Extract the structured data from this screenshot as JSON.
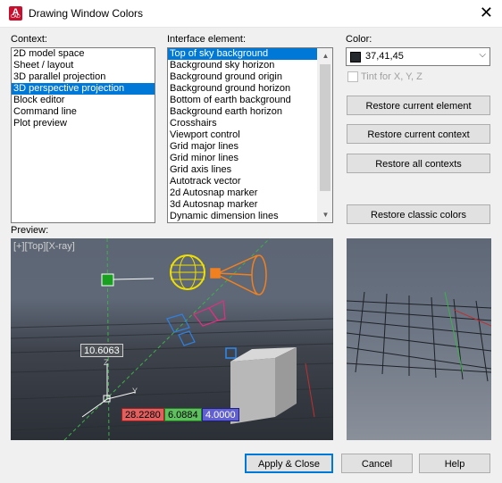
{
  "window": {
    "title": "Drawing Window Colors"
  },
  "context": {
    "label": "Context:",
    "items": [
      "2D model space",
      "Sheet / layout",
      "3D parallel projection",
      "3D perspective projection",
      "Block editor",
      "Command line",
      "Plot preview"
    ],
    "selected": 3
  },
  "interface": {
    "label": "Interface element:",
    "items": [
      "Top of sky background",
      "Background sky horizon",
      "Background ground origin",
      "Background ground horizon",
      "Bottom of earth background",
      "Background earth horizon",
      "Crosshairs",
      "Viewport control",
      "Grid major lines",
      "Grid minor lines",
      "Grid axis lines",
      "Autotrack vector",
      "2d Autosnap marker",
      "3d Autosnap marker",
      "Dynamic dimension lines"
    ],
    "selected": 0
  },
  "color": {
    "label": "Color:",
    "value": "37,41,45",
    "swatch": "#25292d",
    "tint_label": "Tint for X, Y, Z",
    "tint_checked": false
  },
  "buttons": {
    "restore_element": "Restore current element",
    "restore_context": "Restore current context",
    "restore_all": "Restore all contexts",
    "restore_classic": "Restore classic colors",
    "apply": "Apply & Close",
    "cancel": "Cancel",
    "help": "Help"
  },
  "preview": {
    "label": "Preview:",
    "viewport_label": "[+][Top][X-ray]",
    "dim_value": "10.6063",
    "axis_z": "Z",
    "axis_y": "Y",
    "coord_x": "28.2280",
    "coord_y": "6.0884",
    "coord_z": "4.0000"
  }
}
